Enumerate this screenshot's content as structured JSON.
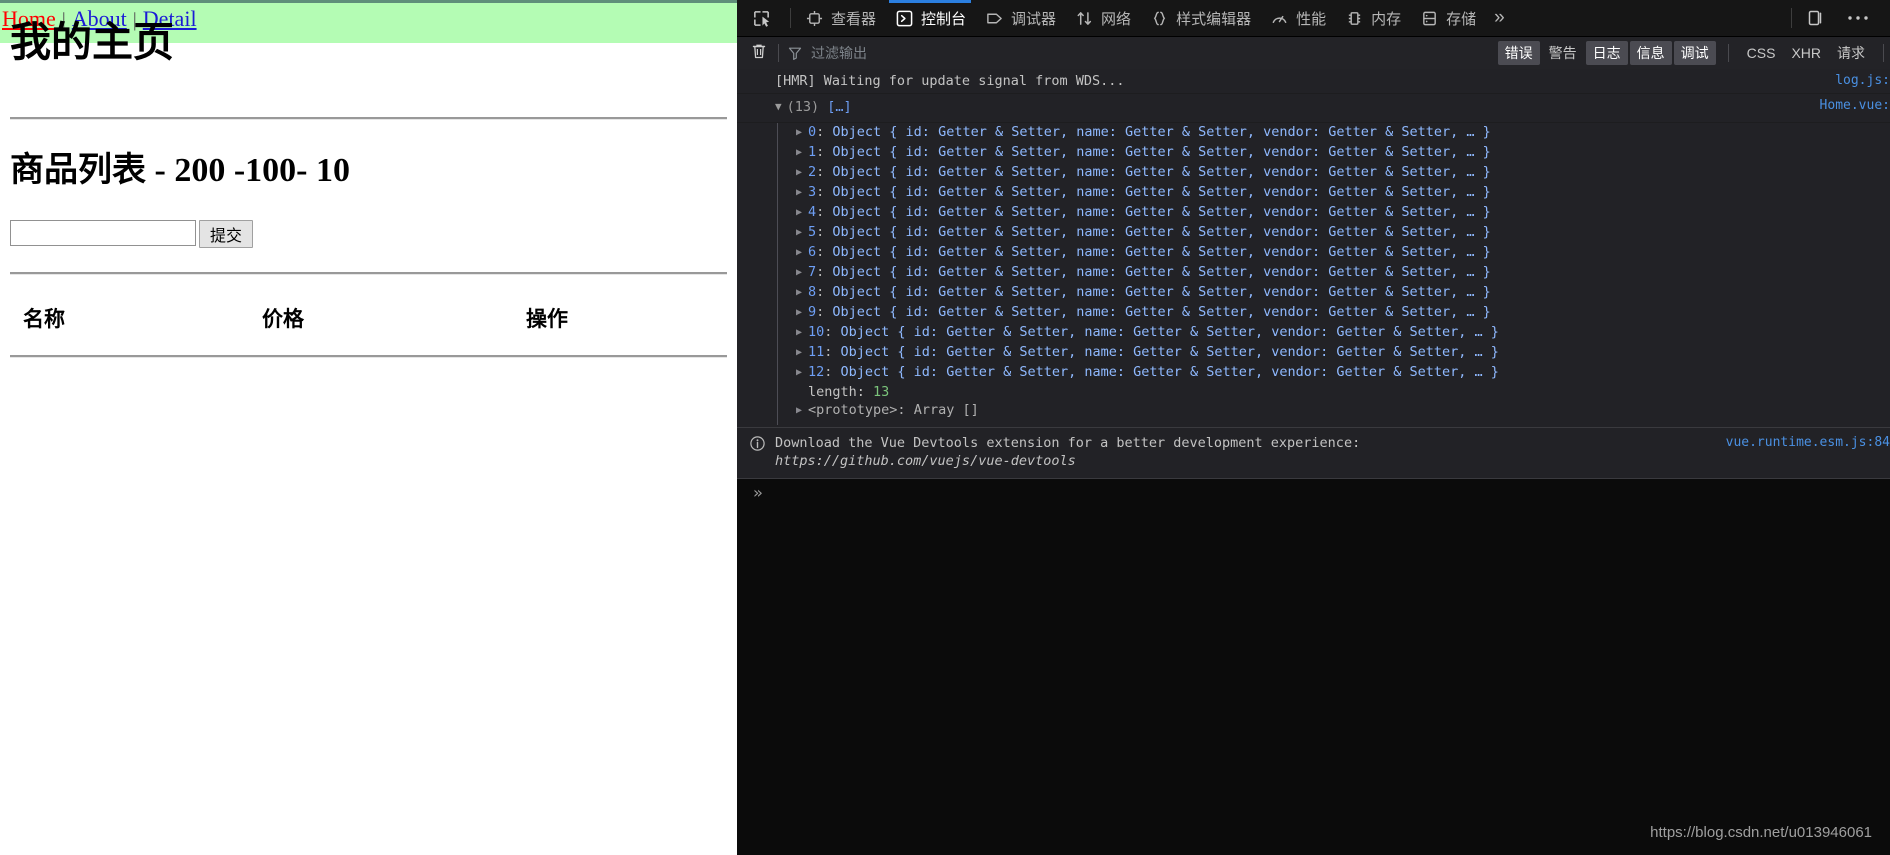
{
  "page": {
    "nav": {
      "items": [
        {
          "label": "Home",
          "state": "active"
        },
        {
          "label": "About",
          "state": "normal"
        },
        {
          "label": "Detail",
          "state": "normal"
        }
      ],
      "separator": "|",
      "background_color": "#b4fcb4",
      "active_color": "#ff0000",
      "link_color": "#1b1bd6"
    },
    "title": "我的主页",
    "list_title": "商品列表 - 200 -100- 10",
    "form": {
      "input_value": "",
      "input_placeholder": "",
      "submit_label": "提交"
    },
    "table": {
      "columns": [
        "名称",
        "价格",
        "操作"
      ],
      "rows": []
    }
  },
  "devtools": {
    "toolbar": {
      "picker_icon": "inspect-picker-icon",
      "tabs": [
        {
          "label": "查看器",
          "icon": "inspector-icon",
          "active": false
        },
        {
          "label": "控制台",
          "icon": "console-icon",
          "active": true
        },
        {
          "label": "调试器",
          "icon": "debugger-icon",
          "active": false
        },
        {
          "label": "网络",
          "icon": "network-icon",
          "active": false
        },
        {
          "label": "样式编辑器",
          "icon": "style-editor-icon",
          "active": false
        },
        {
          "label": "性能",
          "icon": "performance-icon",
          "active": false
        },
        {
          "label": "内存",
          "icon": "memory-icon",
          "active": false
        },
        {
          "label": "存储",
          "icon": "storage-icon",
          "active": false
        }
      ],
      "overflow_label": "»",
      "dock_icon": "dock-layout-icon",
      "menu_icon": "more-options-icon",
      "active_tab_underline_color": "#2b7fe0"
    },
    "filterbar": {
      "clear_icon": "trash-icon",
      "filter_icon": "filter-icon",
      "filter_value": "",
      "filter_placeholder": "过滤输出",
      "levels": [
        {
          "label": "错误",
          "selected": true
        },
        {
          "label": "警告",
          "selected": false
        },
        {
          "label": "日志",
          "selected": true
        },
        {
          "label": "信息",
          "selected": true
        },
        {
          "label": "调试",
          "selected": true
        }
      ],
      "types": [
        {
          "label": "CSS"
        },
        {
          "label": "XHR"
        },
        {
          "label": "请求"
        }
      ]
    },
    "console": {
      "hmr_message": "[HMR] Waiting for update signal from WDS...",
      "hmr_source": "log.js:",
      "group": {
        "arrow": "▼",
        "count": "(13)",
        "bracket": "[…]",
        "source": "Home.vue:",
        "object_rows": [
          {
            "index": "0",
            "text": "Object { id: Getter & Setter, name: Getter & Setter, vendor: Getter & Setter, … }"
          },
          {
            "index": "1",
            "text": "Object { id: Getter & Setter, name: Getter & Setter, vendor: Getter & Setter, … }"
          },
          {
            "index": "2",
            "text": "Object { id: Getter & Setter, name: Getter & Setter, vendor: Getter & Setter, … }"
          },
          {
            "index": "3",
            "text": "Object { id: Getter & Setter, name: Getter & Setter, vendor: Getter & Setter, … }"
          },
          {
            "index": "4",
            "text": "Object { id: Getter & Setter, name: Getter & Setter, vendor: Getter & Setter, … }"
          },
          {
            "index": "5",
            "text": "Object { id: Getter & Setter, name: Getter & Setter, vendor: Getter & Setter, … }"
          },
          {
            "index": "6",
            "text": "Object { id: Getter & Setter, name: Getter & Setter, vendor: Getter & Setter, … }"
          },
          {
            "index": "7",
            "text": "Object { id: Getter & Setter, name: Getter & Setter, vendor: Getter & Setter, … }"
          },
          {
            "index": "8",
            "text": "Object { id: Getter & Setter, name: Getter & Setter, vendor: Getter & Setter, … }"
          },
          {
            "index": "9",
            "text": "Object { id: Getter & Setter, name: Getter & Setter, vendor: Getter & Setter, … }"
          },
          {
            "index": "10",
            "text": "Object { id: Getter & Setter, name: Getter & Setter, vendor: Getter & Setter, … }"
          },
          {
            "index": "11",
            "text": "Object { id: Getter & Setter, name: Getter & Setter, vendor: Getter & Setter, … }"
          },
          {
            "index": "12",
            "text": "Object { id: Getter & Setter, name: Getter & Setter, vendor: Getter & Setter, … }"
          }
        ],
        "length_key": "length:",
        "length_value": "13",
        "prototype_key": "<prototype>:",
        "prototype_value": "Array []"
      },
      "info": {
        "icon": "info-circle-icon",
        "message": "Download the Vue Devtools extension for a better development experience:",
        "link": "https://github.com/vuejs/vue-devtools",
        "source": "vue.runtime.esm.js:84"
      },
      "prompt_symbol": "»",
      "prompt_value": ""
    },
    "watermark": "https://blog.csdn.net/u013946061"
  }
}
